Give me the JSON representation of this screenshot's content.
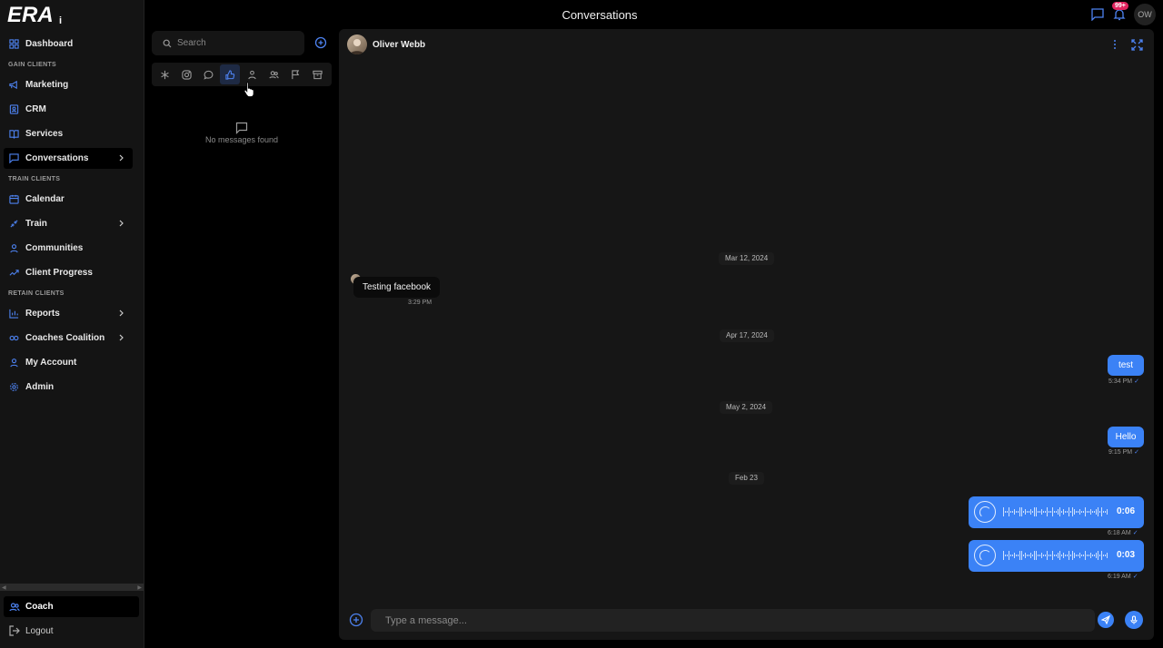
{
  "app": {
    "logo_text": "ERAi",
    "header_title": "Conversations",
    "notification_badge": "99+",
    "user_initials": "OW"
  },
  "sidebar": {
    "sections": {
      "gain": "GAIN CLIENTS",
      "train": "TRAIN CLIENTS",
      "retain": "RETAIN CLIENTS"
    },
    "items": [
      {
        "label": "Dashboard",
        "icon": "grid-icon"
      },
      {
        "label": "Marketing",
        "icon": "megaphone-icon"
      },
      {
        "label": "CRM",
        "icon": "contact-icon"
      },
      {
        "label": "Services",
        "icon": "book-icon"
      },
      {
        "label": "Conversations",
        "icon": "chat-icon",
        "active": true
      },
      {
        "label": "Calendar",
        "icon": "calendar-icon"
      },
      {
        "label": "Train",
        "icon": "dumbbell-icon"
      },
      {
        "label": "Communities",
        "icon": "user-icon"
      },
      {
        "label": "Client Progress",
        "icon": "trend-icon"
      },
      {
        "label": "Reports",
        "icon": "chart-icon"
      },
      {
        "label": "Coaches Coalition",
        "icon": "infinity-icon"
      },
      {
        "label": "My Account",
        "icon": "user-icon"
      },
      {
        "label": "Admin",
        "icon": "gear-icon"
      }
    ],
    "coach_label": "Coach",
    "logout_label": "Logout"
  },
  "conversation_list": {
    "search_placeholder": "Search",
    "empty_text": "No messages found",
    "filters": [
      "all",
      "instagram",
      "sms",
      "messenger",
      "client",
      "group",
      "flagged",
      "archive"
    ],
    "active_filter": "messenger"
  },
  "chat": {
    "contact_name": "Oliver Webb",
    "composer_placeholder": "Type a message...",
    "dates": [
      "Mar 12, 2024",
      "Apr 17, 2024",
      "May 2, 2024",
      "Feb 23"
    ],
    "messages": [
      {
        "direction": "in",
        "text": "Testing facebook",
        "time": "3:29 PM"
      },
      {
        "direction": "out",
        "text": "test",
        "time": "5:34 PM"
      },
      {
        "direction": "out",
        "text": "Hello",
        "time": "9:15 PM"
      },
      {
        "direction": "out",
        "type": "voice",
        "duration": "0:06",
        "time": "6:18 AM"
      },
      {
        "direction": "out",
        "type": "voice",
        "duration": "0:03",
        "time": "6:19 AM"
      }
    ]
  },
  "colors": {
    "accent": "#3b82f6",
    "badge": "#e0245e",
    "background": "#000000"
  }
}
